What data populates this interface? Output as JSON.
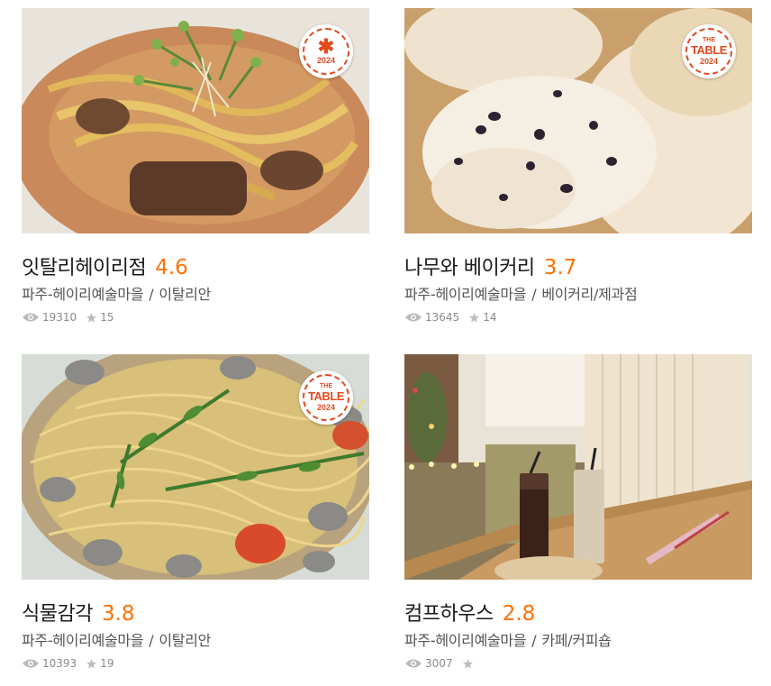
{
  "restaurants": [
    {
      "name": "잇탈리헤이리점",
      "rating": "4.6",
      "location": "파주-헤이리예술마을",
      "category": "이탈리안",
      "views": "19310",
      "stars": "15",
      "badge": {
        "type": "star",
        "year": "2024"
      }
    },
    {
      "name": "나무와 베이커리",
      "rating": "3.7",
      "location": "파주-헤이리예술마을",
      "category": "베이커리/제과점",
      "views": "13645",
      "stars": "14",
      "badge": {
        "type": "table",
        "the": "THE",
        "table": "TABLE",
        "year": "2024"
      }
    },
    {
      "name": "식물감각",
      "rating": "3.8",
      "location": "파주-헤이리예술마을",
      "category": "이탈리안",
      "views": "10393",
      "stars": "19",
      "badge": {
        "type": "table",
        "the": "THE",
        "table": "TABLE",
        "year": "2024"
      }
    },
    {
      "name": "컴프하우스",
      "rating": "2.8",
      "location": "파주-헤이리예술마을",
      "category": "카페/커피숍",
      "views": "3007",
      "stars": "",
      "badge": null
    }
  ],
  "separator": "/",
  "colors": {
    "rating": "#ff7100",
    "badge": "#e24a1f",
    "meta": "#555555",
    "stats": "#8a8a8a"
  }
}
